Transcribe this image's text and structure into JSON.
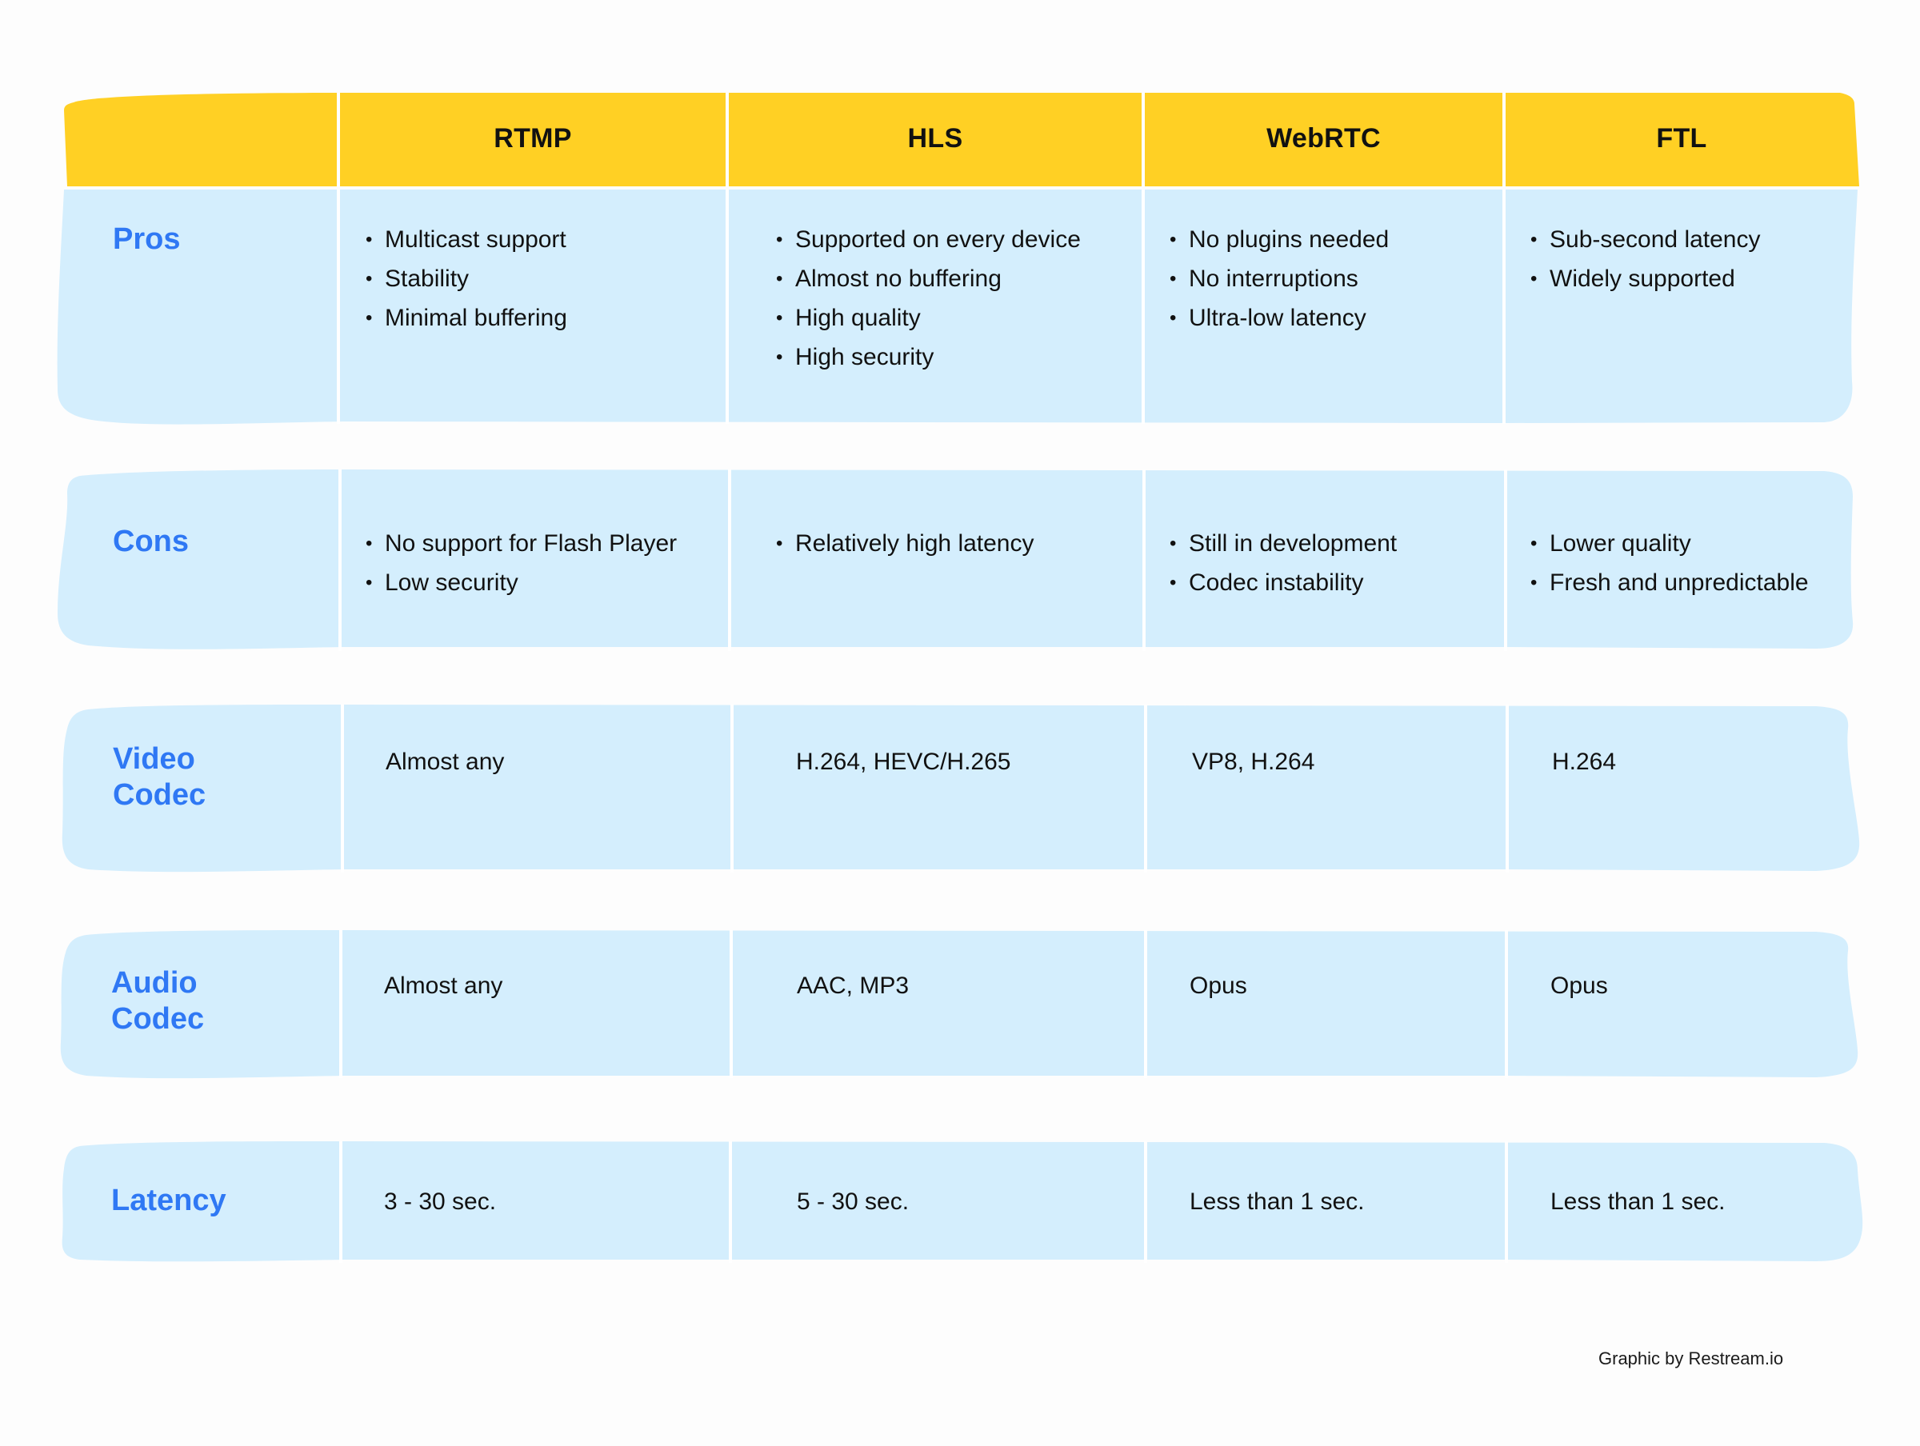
{
  "colors": {
    "header_bg": "#ffd024",
    "row_bg": "#d4eefd",
    "label": "#2f78f4",
    "text": "#111111",
    "divider": "#ffffff"
  },
  "columns": [
    "RTMP",
    "HLS",
    "WebRTC",
    "FTL"
  ],
  "rows": {
    "pros": {
      "label": "Pros",
      "cells": [
        [
          "Multicast support",
          "Stability",
          "Minimal buffering"
        ],
        [
          "Supported on every device",
          "Almost no buffering",
          "High quality",
          "High security"
        ],
        [
          "No plugins needed",
          "No interruptions",
          "Ultra-low latency"
        ],
        [
          "Sub-second latency",
          "Widely supported"
        ]
      ]
    },
    "cons": {
      "label": "Cons",
      "cells": [
        [
          "No support for Flash Player",
          "Low security"
        ],
        [
          "Relatively high latency"
        ],
        [
          "Still in development",
          "Codec instability"
        ],
        [
          "Lower quality",
          "Fresh and unpredictable"
        ]
      ]
    },
    "video_codec": {
      "label": "Video\nCodec",
      "cells": [
        "Almost any",
        "H.264, HEVC/H.265",
        "VP8, H.264",
        "H.264"
      ]
    },
    "audio_codec": {
      "label": "Audio\nCodec",
      "cells": [
        "Almost any",
        "AAC, MP3",
        "Opus",
        "Opus"
      ]
    },
    "latency": {
      "label": "Latency",
      "cells": [
        "3 - 30 sec.",
        "5 - 30 sec.",
        "Less than 1 sec.",
        "Less than 1 sec."
      ]
    }
  },
  "footer": "Graphic by Restream.io",
  "bullet": "•"
}
